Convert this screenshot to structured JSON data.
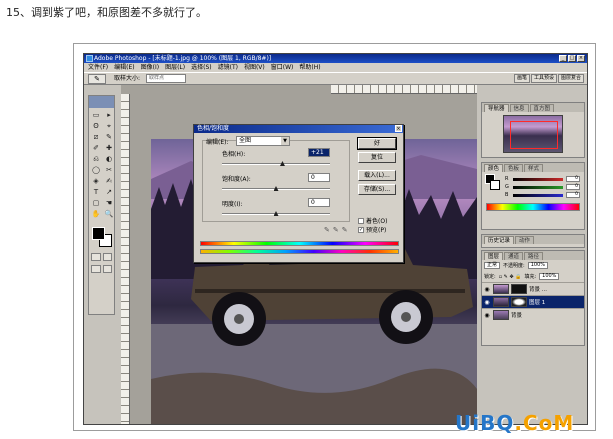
{
  "caption": "15、调到紫了吧，和原图差不多就行了。",
  "photoshop": {
    "window_title": "Adobe Photoshop - [未标题-1.jpg @ 100% (图层 1, RGB/8#)]",
    "menu": [
      "文件(F)",
      "编辑(E)",
      "图像(I)",
      "图层(L)",
      "选择(S)",
      "滤镜(T)",
      "视图(V)",
      "窗口(W)",
      "帮助(H)"
    ],
    "options_bar": {
      "tool_label": "取样大小:",
      "sample_size": "取样点",
      "well_tabs": [
        "画笔",
        "工具预设",
        "图层复合"
      ]
    },
    "toolbox": {
      "tools": [
        "▭",
        "▸",
        "ʘ",
        "⌖",
        "⧄",
        "✎",
        "✐",
        "✚",
        "⎌",
        "◐",
        "◯",
        "✂",
        "◈",
        "✍",
        "T",
        "↗",
        "▢",
        "☚",
        "✋",
        "🔍"
      ]
    },
    "hue_dialog": {
      "title": "色相/饱和度",
      "edit_label": "编辑(E):",
      "edit_value": "全图",
      "sliders": [
        {
          "label": "色相(H):",
          "value": "+21",
          "level": 0.56
        },
        {
          "label": "饱和度(A):",
          "value": "0",
          "level": 0.5
        },
        {
          "label": "明度(I):",
          "value": "0",
          "level": 0.5
        }
      ],
      "buttons": {
        "ok": "好",
        "cancel": "复位",
        "load": "载入(L)...",
        "save": "存储(S)..."
      },
      "colorize_label": "着色(O)",
      "colorize_checked": false,
      "preview_label": "预览(P)",
      "preview_checked": true
    },
    "navigator": {
      "tabs": [
        "导航器",
        "信息",
        "直方图"
      ]
    },
    "color": {
      "tabs": [
        "颜色",
        "色板",
        "样式"
      ],
      "channels": [
        {
          "label": "R",
          "value": "0",
          "color": "#cc2a2a"
        },
        {
          "label": "G",
          "value": "0",
          "color": "#2a9a2a"
        },
        {
          "label": "B",
          "value": "0",
          "color": "#2a2acc"
        }
      ]
    },
    "history": {
      "tabs": [
        "历史记录",
        "动作"
      ]
    },
    "layers": {
      "tabs": [
        "图层",
        "通道",
        "路径"
      ],
      "blend_mode": "正常",
      "opacity_label": "不透明度:",
      "opacity_value": "100%",
      "lock_label": "锁定:",
      "fill_label": "填充:",
      "fill_value": "100%",
      "items": [
        {
          "name": "背景 ...",
          "active": false
        },
        {
          "name": "图层 1",
          "active": true
        },
        {
          "name": "背景",
          "active": false
        }
      ]
    }
  },
  "watermark": {
    "text_a": "UiBQ",
    "text_b": ".CoM"
  }
}
